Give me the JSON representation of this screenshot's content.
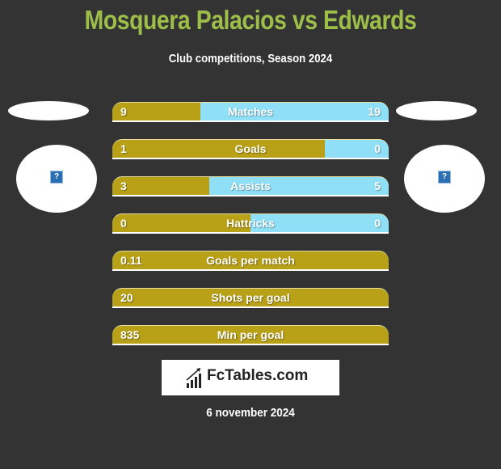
{
  "header": {
    "title": "Mosquera Palacios vs Edwards",
    "subtitle": "Club competitions, Season 2024"
  },
  "colors": {
    "left": "#b8a017",
    "right": "#8fe0f7",
    "title": "#9dbf4a",
    "background": "#333333"
  },
  "players": {
    "left": {
      "image_icon": "broken-image-icon",
      "icon_glyph": "?"
    },
    "right": {
      "image_icon": "broken-image-icon",
      "icon_glyph": "?"
    }
  },
  "stats": [
    {
      "label": "Matches",
      "left": "9",
      "right": "19",
      "left_share": 0.32
    },
    {
      "label": "Goals",
      "left": "1",
      "right": "0",
      "left_share": 0.77
    },
    {
      "label": "Assists",
      "left": "3",
      "right": "5",
      "left_share": 0.35
    },
    {
      "label": "Hattricks",
      "left": "0",
      "right": "0",
      "left_share": 0.5
    },
    {
      "label": "Goals per match",
      "left": "0.11",
      "right": "",
      "left_share": 1
    },
    {
      "label": "Shots per goal",
      "left": "20",
      "right": "",
      "left_share": 1
    },
    {
      "label": "Min per goal",
      "left": "835",
      "right": "",
      "left_share": 1
    }
  ],
  "footer": {
    "logo_text": "FcTables.com",
    "date": "6 november 2024"
  }
}
